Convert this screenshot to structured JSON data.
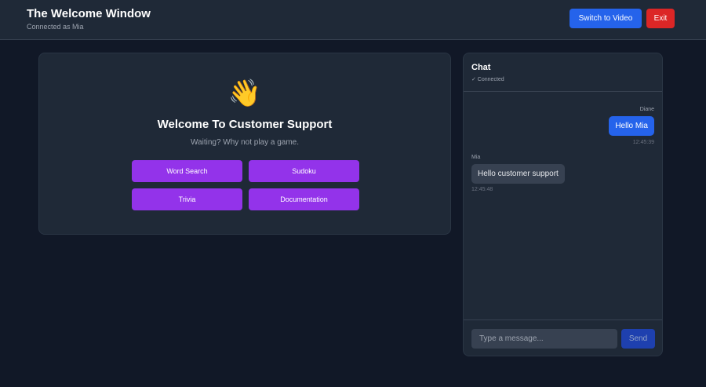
{
  "header": {
    "title": "The Welcome Window",
    "subtitle": "Connected as Mia",
    "switch_label": "Switch to Video",
    "exit_label": "Exit"
  },
  "welcome": {
    "icon": "waving-hand-icon",
    "emoji": "👋",
    "title": "Welcome To Customer Support",
    "subtitle": "Waiting? Why not play a game.",
    "games": [
      "Word Search",
      "Sudoku",
      "Trivia",
      "Documentation"
    ]
  },
  "chat": {
    "title": "Chat",
    "status": "✓ Connected",
    "messages": [
      {
        "sender": "Diane",
        "text": "Hello Mia",
        "time": "12:45:39",
        "direction": "outgoing"
      },
      {
        "sender": "Mia",
        "text": "Hello customer support",
        "time": "12:45:48",
        "direction": "incoming"
      }
    ],
    "input_placeholder": "Type a message...",
    "send_label": "Send"
  },
  "colors": {
    "background": "#111827",
    "panel": "#1f2937",
    "primary": "#2563eb",
    "danger": "#dc2626",
    "game_button": "#9333ea"
  }
}
